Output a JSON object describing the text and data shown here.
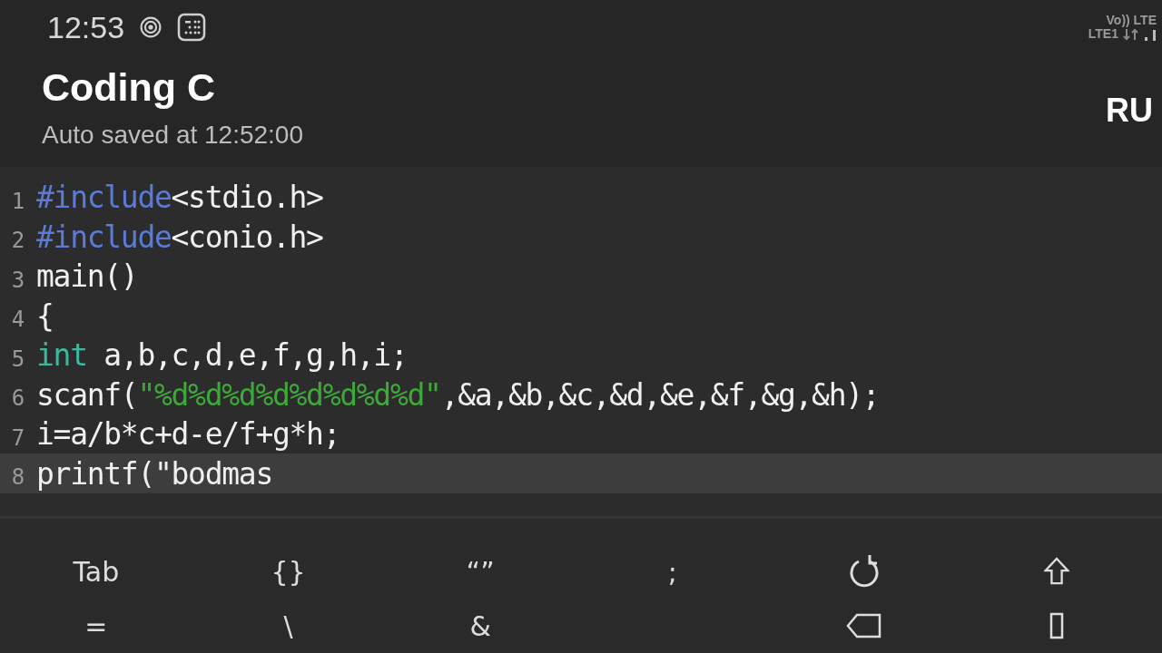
{
  "status_bar": {
    "time": "12:53",
    "volte": "Vo)) LTE",
    "network": "LTE1"
  },
  "header": {
    "title": "Coding C",
    "subtitle": "Auto saved at 12:52:00",
    "run_button": "RU"
  },
  "editor": {
    "lines": [
      {
        "number": "1",
        "current": false,
        "tokens": [
          {
            "kind": "keyword",
            "text": "#include"
          },
          {
            "kind": "plain",
            "text": "<stdio.h>"
          }
        ]
      },
      {
        "number": "2",
        "current": false,
        "tokens": [
          {
            "kind": "keyword",
            "text": "#include"
          },
          {
            "kind": "plain",
            "text": "<conio.h>"
          }
        ]
      },
      {
        "number": "3",
        "current": false,
        "tokens": [
          {
            "kind": "plain",
            "text": "main()"
          }
        ]
      },
      {
        "number": "4",
        "current": false,
        "tokens": [
          {
            "kind": "plain",
            "text": "{"
          }
        ]
      },
      {
        "number": "5",
        "current": false,
        "tokens": [
          {
            "kind": "type",
            "text": "int"
          },
          {
            "kind": "plain",
            "text": " a,b,c,d,e,f,g,h,i;"
          }
        ]
      },
      {
        "number": "6",
        "current": false,
        "tokens": [
          {
            "kind": "plain",
            "text": "scanf("
          },
          {
            "kind": "string",
            "text": "\"%d%d%d%d%d%d%d%d\""
          },
          {
            "kind": "plain",
            "text": ",&a,&b,&c,&d,&e,&f,&g,&h);"
          }
        ]
      },
      {
        "number": "7",
        "current": false,
        "tokens": [
          {
            "kind": "plain",
            "text": "i=a/b*c+d-e/f+g*h;"
          }
        ]
      },
      {
        "number": "8",
        "current": true,
        "tokens": [
          {
            "kind": "plain",
            "text": "printf(\"bodmas"
          }
        ]
      }
    ]
  },
  "key_bar": {
    "rows": [
      [
        {
          "kind": "text",
          "label": "Tab"
        },
        {
          "kind": "text",
          "label": "{}"
        },
        {
          "kind": "text",
          "label": "“”"
        },
        {
          "kind": "text",
          "label": ";"
        },
        {
          "kind": "undo"
        },
        {
          "kind": "shift"
        }
      ],
      [
        {
          "kind": "text",
          "label": "="
        },
        {
          "kind": "text",
          "label": "\\"
        },
        {
          "kind": "text",
          "label": "&"
        },
        {
          "kind": "blank"
        },
        {
          "kind": "back"
        },
        {
          "kind": "box"
        }
      ]
    ]
  }
}
